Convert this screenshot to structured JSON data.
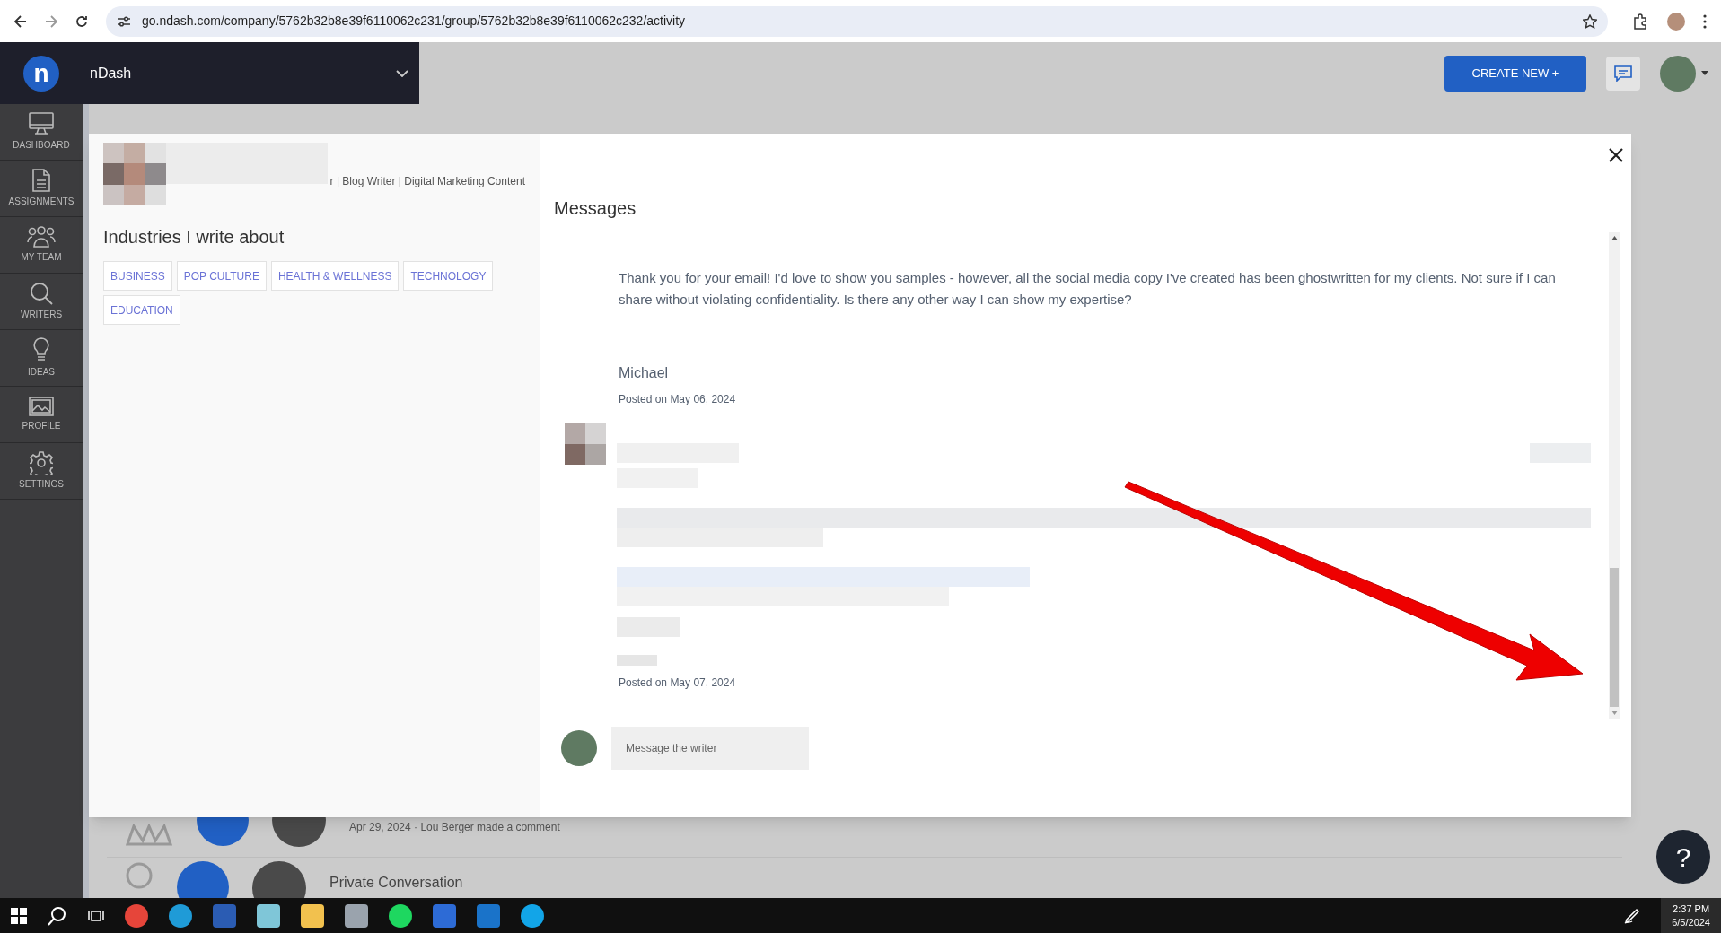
{
  "browser": {
    "url": "go.ndash.com/company/5762b32b8e39f6110062c231/group/5762b32b8e39f6110062c232/activity"
  },
  "app_header": {
    "logo": "n",
    "workspace": "nDash",
    "create_button": "CREATE NEW +"
  },
  "sidebar": {
    "items": [
      {
        "kind": "monitor",
        "label": "DASHBOARD"
      },
      {
        "kind": "document",
        "label": "ASSIGNMENTS"
      },
      {
        "kind": "team",
        "label": "MY TEAM"
      },
      {
        "kind": "search",
        "label": "WRITERS"
      },
      {
        "kind": "bulb",
        "label": "IDEAS"
      },
      {
        "kind": "image",
        "label": "PROFILE"
      },
      {
        "kind": "gear",
        "label": "SETTINGS"
      }
    ]
  },
  "background_rows": [
    {
      "kind": "comment",
      "text": "Apr 29, 2024 · Lou Berger made a comment"
    },
    {
      "kind": "conversation",
      "text": "Private Conversation"
    }
  ],
  "profile_panel": {
    "tagline": "r | Blog Writer | Digital Marketing Content",
    "section_title": "Industries I write about",
    "industries": [
      "BUSINESS",
      "POP CULTURE",
      "HEALTH & WELLNESS",
      "TECHNOLOGY",
      "EDUCATION"
    ]
  },
  "messages": {
    "title": "Messages",
    "items": [
      {
        "kind": "text",
        "body": "Thank you for your email! I'd love to show you samples - however, all the social media copy I've created has been ghostwritten for my clients. Not sure if I can share without violating confidentiality. Is there any other way I can show my expertise?",
        "author": "Michael",
        "posted": "Posted on May 06, 2024"
      },
      {
        "kind": "blurred",
        "posted": "Posted on May 07, 2024"
      }
    ],
    "composer": {
      "placeholder": "Message the writer"
    }
  },
  "help_button": "?",
  "taskbar": {
    "time": "2:37 PM",
    "date": "6/5/2024"
  }
}
